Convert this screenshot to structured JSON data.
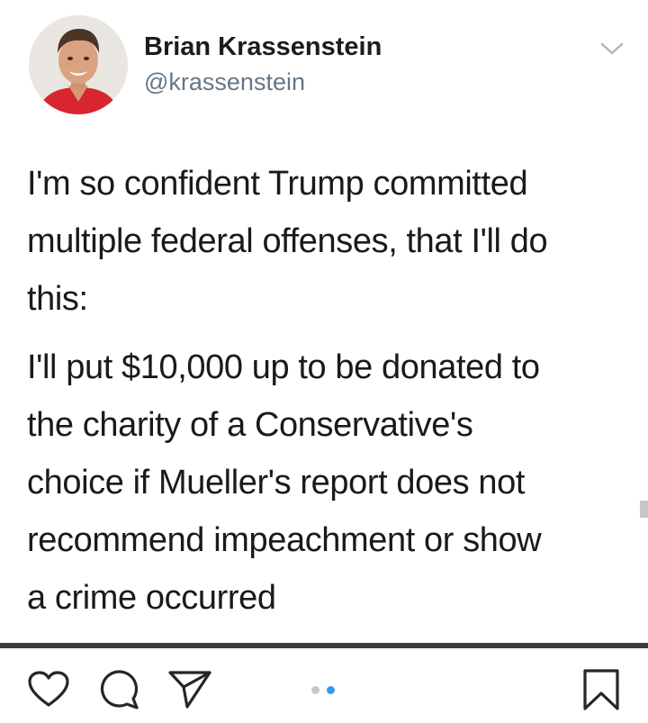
{
  "tweet": {
    "author_name": "Brian Krassenstein",
    "author_handle": "@krassenstein",
    "paragraphs": [
      "I'm so confident Trump committed\nmultiple federal offenses, that I'll do\nthis:",
      "I'll put $10,000 up to be donated to\nthe charity of a Conservative's\nchoice if Mueller's report does not\nrecommend impeachment or show\na crime occurred"
    ]
  },
  "icons": {
    "menu": "chevron-down-icon",
    "like": "heart-icon",
    "comment": "comment-icon",
    "share": "send-icon",
    "save": "bookmark-icon"
  },
  "carousel": {
    "current_page": 2,
    "total_pages": 2
  },
  "colors": {
    "text": "#1a1a1a",
    "handle": "#657786",
    "active_dot": "#3897f0",
    "inactive_dot": "#c7c7c7",
    "divider": "#3a3a3a"
  }
}
